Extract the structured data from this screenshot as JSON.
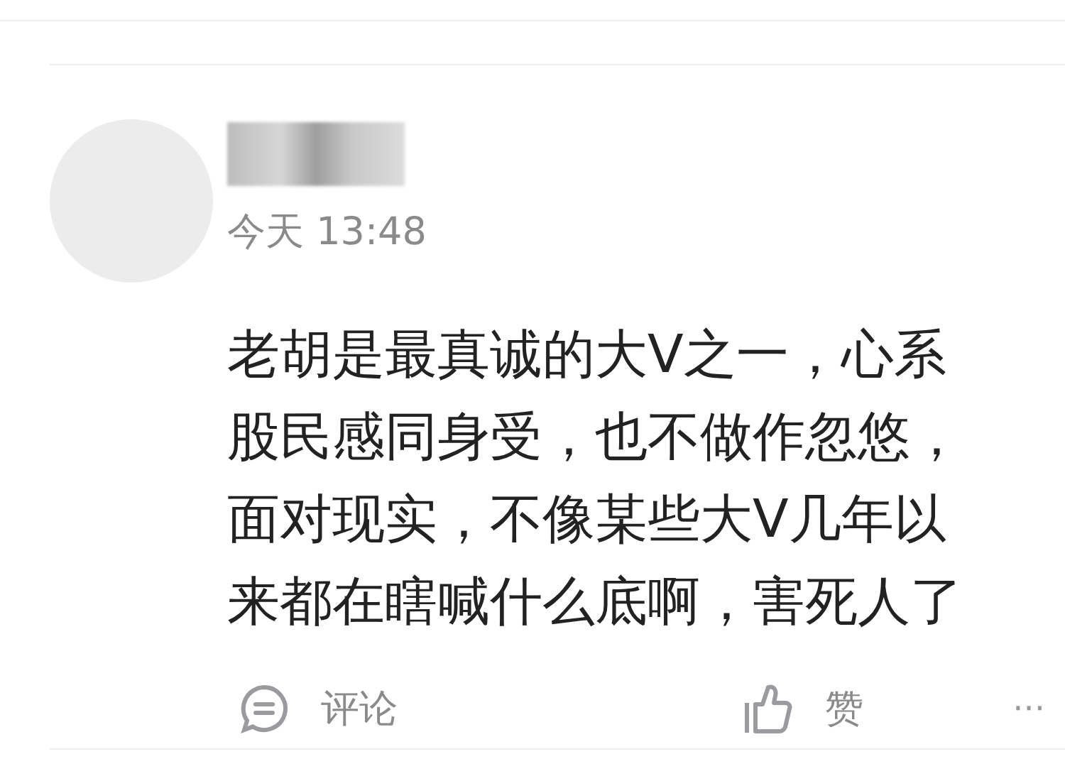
{
  "comment": {
    "time": "今天 13:48",
    "text": "老胡是最真诚的大V之一，心系股民感同身受，也不做作忽悠，面对现实，不像某些大V几年以来都在瞎喊什么底啊，害死人了"
  },
  "actions": {
    "comment_label": "评论",
    "like_label": "赞",
    "more": "···"
  }
}
